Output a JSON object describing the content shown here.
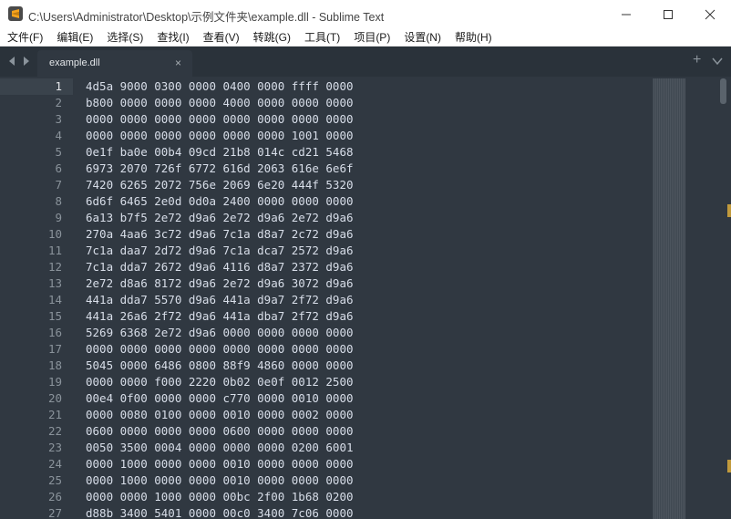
{
  "window": {
    "title": "C:\\Users\\Administrator\\Desktop\\示例文件夹\\example.dll - Sublime Text",
    "controls": [
      "minimize-icon",
      "maximize-icon",
      "close-icon"
    ]
  },
  "menu": [
    {
      "label": "文件(F)"
    },
    {
      "label": "编辑(E)"
    },
    {
      "label": "选择(S)"
    },
    {
      "label": "查找(I)"
    },
    {
      "label": "查看(V)"
    },
    {
      "label": "转跳(G)"
    },
    {
      "label": "工具(T)"
    },
    {
      "label": "项目(P)"
    },
    {
      "label": "设置(N)"
    },
    {
      "label": "帮助(H)"
    }
  ],
  "tabs": [
    {
      "label": "example.dll",
      "close": "×",
      "active": true
    }
  ],
  "tabbar": {
    "new_tab": "+"
  },
  "colors": {
    "editor_bg": "#303841",
    "accent": "#f6a21c"
  },
  "editor": {
    "active_line": 1,
    "lines": [
      {
        "num": "1",
        "text": "4d5a 9000 0300 0000 0400 0000 ffff 0000"
      },
      {
        "num": "2",
        "text": "b800 0000 0000 0000 4000 0000 0000 0000"
      },
      {
        "num": "3",
        "text": "0000 0000 0000 0000 0000 0000 0000 0000"
      },
      {
        "num": "4",
        "text": "0000 0000 0000 0000 0000 0000 1001 0000"
      },
      {
        "num": "5",
        "text": "0e1f ba0e 00b4 09cd 21b8 014c cd21 5468"
      },
      {
        "num": "6",
        "text": "6973 2070 726f 6772 616d 2063 616e 6e6f"
      },
      {
        "num": "7",
        "text": "7420 6265 2072 756e 2069 6e20 444f 5320"
      },
      {
        "num": "8",
        "text": "6d6f 6465 2e0d 0d0a 2400 0000 0000 0000"
      },
      {
        "num": "9",
        "text": "6a13 b7f5 2e72 d9a6 2e72 d9a6 2e72 d9a6"
      },
      {
        "num": "10",
        "text": "270a 4aa6 3c72 d9a6 7c1a d8a7 2c72 d9a6"
      },
      {
        "num": "11",
        "text": "7c1a daa7 2d72 d9a6 7c1a dca7 2572 d9a6"
      },
      {
        "num": "12",
        "text": "7c1a dda7 2672 d9a6 4116 d8a7 2372 d9a6"
      },
      {
        "num": "13",
        "text": "2e72 d8a6 8172 d9a6 2e72 d9a6 3072 d9a6"
      },
      {
        "num": "14",
        "text": "441a dda7 5570 d9a6 441a d9a7 2f72 d9a6"
      },
      {
        "num": "15",
        "text": "441a 26a6 2f72 d9a6 441a dba7 2f72 d9a6"
      },
      {
        "num": "16",
        "text": "5269 6368 2e72 d9a6 0000 0000 0000 0000"
      },
      {
        "num": "17",
        "text": "0000 0000 0000 0000 0000 0000 0000 0000"
      },
      {
        "num": "18",
        "text": "5045 0000 6486 0800 88f9 4860 0000 0000"
      },
      {
        "num": "19",
        "text": "0000 0000 f000 2220 0b02 0e0f 0012 2500"
      },
      {
        "num": "20",
        "text": "00e4 0f00 0000 0000 c770 0000 0010 0000"
      },
      {
        "num": "21",
        "text": "0000 0080 0100 0000 0010 0000 0002 0000"
      },
      {
        "num": "22",
        "text": "0600 0000 0000 0000 0600 0000 0000 0000"
      },
      {
        "num": "23",
        "text": "0050 3500 0004 0000 0000 0000 0200 6001"
      },
      {
        "num": "24",
        "text": "0000 1000 0000 0000 0010 0000 0000 0000"
      },
      {
        "num": "25",
        "text": "0000 1000 0000 0000 0010 0000 0000 0000"
      },
      {
        "num": "26",
        "text": "0000 0000 1000 0000 00bc 2f00 1b68 0200"
      },
      {
        "num": "27",
        "text": "d88b 3400 5401 0000 00c0 3400 7c06 0000"
      }
    ]
  }
}
